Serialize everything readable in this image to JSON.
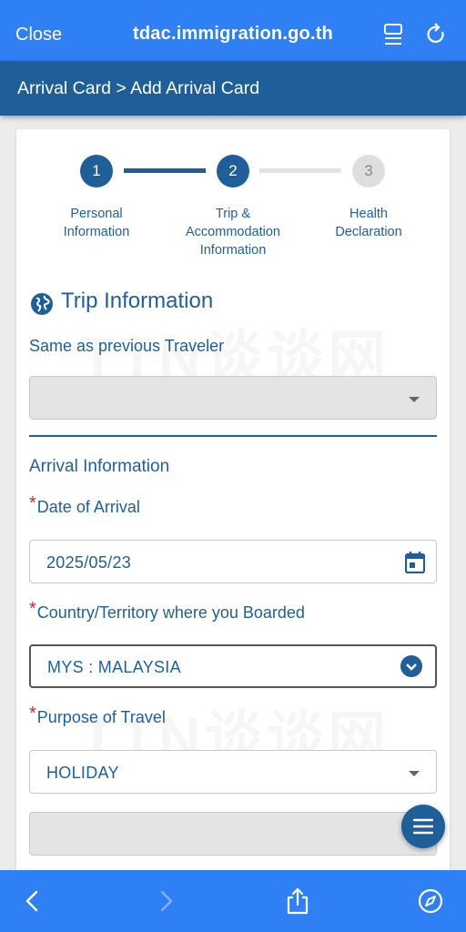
{
  "browser": {
    "close_label": "Close",
    "url": "tdac.immigration.go.th"
  },
  "breadcrumb": "Arrival Card > Add Arrival Card",
  "stepper": {
    "steps": [
      {
        "number": "1",
        "label_line1": "Personal",
        "label_line2": "Information",
        "label_line3": "",
        "state": "active"
      },
      {
        "number": "2",
        "label_line1": "Trip &",
        "label_line2": "Accommodation",
        "label_line3": "Information",
        "state": "active"
      },
      {
        "number": "3",
        "label_line1": "Health",
        "label_line2": "Declaration",
        "label_line3": "",
        "state": "inactive"
      }
    ]
  },
  "trip": {
    "title": "Trip Information",
    "same_as_label": "Same as previous Traveler",
    "same_as_value": ""
  },
  "arrival": {
    "heading": "Arrival Information",
    "required_mark": "*",
    "date_label": "Date of Arrival",
    "date_value": "2025/05/23",
    "country_label": "Country/Territory where you Boarded",
    "country_value": "MYS : MALAYSIA",
    "purpose_label": "Purpose of Travel",
    "purpose_value": "HOLIDAY",
    "purpose_other_value": ""
  },
  "watermark": "TTN谈谈网",
  "colors": {
    "browser_blue": "#2f7ff5",
    "brand_navy": "#1f5f99",
    "required_red": "#d9262c"
  },
  "icons": {
    "reader": "reader-mode-icon",
    "reload": "reload-icon",
    "globe": "globe-icon",
    "calendar": "calendar-icon",
    "menu": "hamburger-menu-icon",
    "back": "chevron-left-icon",
    "forward": "chevron-right-icon",
    "share": "share-icon",
    "compass": "compass-icon"
  }
}
